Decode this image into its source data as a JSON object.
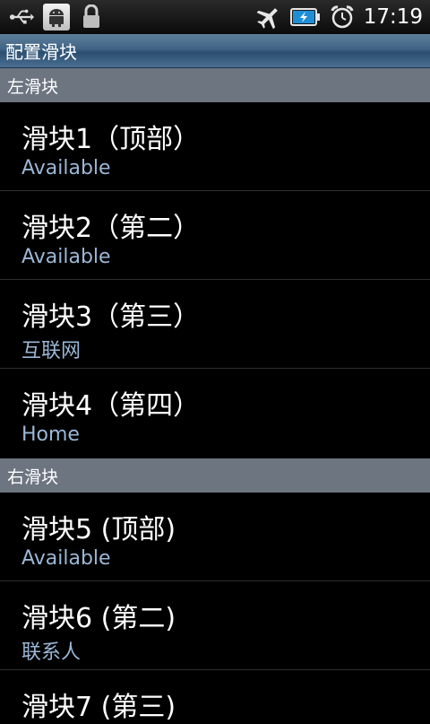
{
  "status_bar": {
    "time": "17:19",
    "icons": [
      "usb-icon",
      "android-debug-icon",
      "lock-icon",
      "airplane-mode-icon",
      "battery-charging-icon",
      "alarm-icon"
    ]
  },
  "title": "配置滑块",
  "sections": [
    {
      "header": "左滑块",
      "items": [
        {
          "title": "滑块1（顶部）",
          "summary": "Available"
        },
        {
          "title": "滑块2（第二）",
          "summary": "Available"
        },
        {
          "title": "滑块3（第三）",
          "summary": "互联网"
        },
        {
          "title": "滑块4（第四）",
          "summary": "Home"
        }
      ]
    },
    {
      "header": "右滑块",
      "items": [
        {
          "title": "滑块5 (顶部)",
          "summary": "Available"
        },
        {
          "title": "滑块6 (第二)",
          "summary": "联系人"
        },
        {
          "title": "滑块7 (第三)",
          "summary": ""
        }
      ]
    }
  ]
}
